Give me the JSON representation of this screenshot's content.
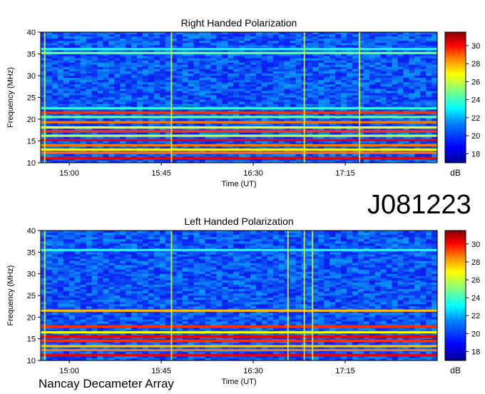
{
  "observation_id": "J081223",
  "instrument": "Nancay Decameter Array",
  "colors": {
    "colormap": [
      "#00008f",
      "#0000ff",
      "#0080ff",
      "#00ffff",
      "#80ff80",
      "#ffff00",
      "#ff8000",
      "#ff0000",
      "#800000"
    ],
    "background_blue": "#1f4fe0"
  },
  "chart_data": [
    {
      "type": "heatmap",
      "title": "Right Handed Polarization",
      "xlabel": "Time (UT)",
      "ylabel": "Frequency (MHz)",
      "x_ticks": [
        "15:00",
        "15:45",
        "16:30",
        "17:15"
      ],
      "x_tick_minutes": [
        900,
        945,
        990,
        1035
      ],
      "xlim_minutes": [
        886,
        1080
      ],
      "y_ticks": [
        "10",
        "15",
        "20",
        "25",
        "30",
        "35",
        "40"
      ],
      "ylim": [
        10,
        40
      ],
      "colorbar": {
        "label": "dB",
        "ticks": [
          "18",
          "20",
          "22",
          "24",
          "26",
          "28",
          "30"
        ],
        "range": [
          17,
          31.5
        ]
      },
      "bands": [
        {
          "freq": 11.0,
          "db": 30
        },
        {
          "freq": 12.3,
          "db": 28
        },
        {
          "freq": 13.0,
          "db": 26
        },
        {
          "freq": 14.0,
          "db": 28
        },
        {
          "freq": 15.2,
          "db": 30
        },
        {
          "freq": 16.2,
          "db": 25
        },
        {
          "freq": 17.2,
          "db": 29
        },
        {
          "freq": 18.1,
          "db": 26
        },
        {
          "freq": 19.3,
          "db": 28
        },
        {
          "freq": 20.5,
          "db": 24
        },
        {
          "freq": 21.5,
          "db": 29
        },
        {
          "freq": 22.5,
          "db": 23
        },
        {
          "freq": 35.2,
          "db": 24
        },
        {
          "freq": 36.1,
          "db": 23
        }
      ],
      "vertical_events_minutes": [
        888,
        950,
        1015,
        1042
      ]
    },
    {
      "type": "heatmap",
      "title": "Left Handed Polarization",
      "xlabel": "Time (UT)",
      "ylabel": "Frequency (MHz)",
      "x_ticks": [
        "15:00",
        "15:45",
        "16:30",
        "17:15"
      ],
      "x_tick_minutes": [
        900,
        945,
        990,
        1035
      ],
      "xlim_minutes": [
        886,
        1080
      ],
      "y_ticks": [
        "10",
        "15",
        "20",
        "25",
        "30",
        "35",
        "40"
      ],
      "ylim": [
        10,
        40
      ],
      "colorbar": {
        "label": "dB",
        "ticks": [
          "18",
          "20",
          "22",
          "24",
          "26",
          "28",
          "30"
        ],
        "range": [
          17,
          31.5
        ]
      },
      "bands": [
        {
          "freq": 11.2,
          "db": 30
        },
        {
          "freq": 12.4,
          "db": 28
        },
        {
          "freq": 13.3,
          "db": 27
        },
        {
          "freq": 14.5,
          "db": 29
        },
        {
          "freq": 15.5,
          "db": 30
        },
        {
          "freq": 16.5,
          "db": 26
        },
        {
          "freq": 17.8,
          "db": 29
        },
        {
          "freq": 21.5,
          "db": 27
        },
        {
          "freq": 35.5,
          "db": 23
        }
      ],
      "vertical_events_minutes": [
        888,
        950,
        1007,
        1015,
        1019
      ]
    }
  ]
}
